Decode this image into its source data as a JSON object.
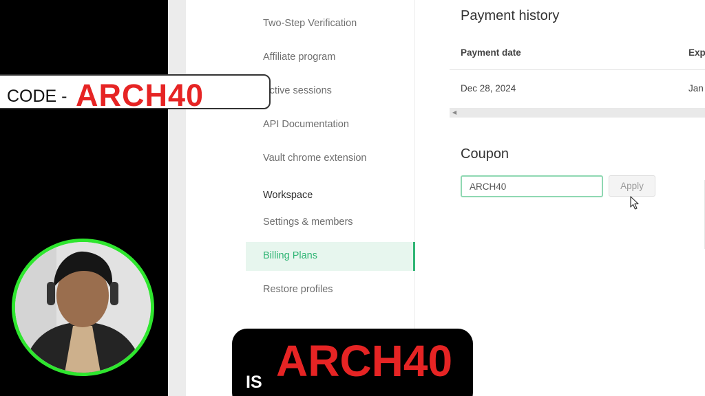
{
  "sidebar": {
    "items": [
      {
        "label": "Two-Step Verification"
      },
      {
        "label": "Affiliate program"
      },
      {
        "label": "Active sessions"
      },
      {
        "label": "API Documentation"
      },
      {
        "label": "Vault chrome extension"
      }
    ],
    "workspace_heading": "Workspace",
    "workspace_items": [
      {
        "label": "Settings & members"
      },
      {
        "label": "Billing Plans",
        "active": true
      },
      {
        "label": "Restore profiles"
      }
    ]
  },
  "payment_history": {
    "title": "Payment history",
    "columns": [
      "Payment date",
      "Exp"
    ],
    "rows": [
      [
        "Dec 28, 2024",
        "Jan"
      ]
    ]
  },
  "coupon": {
    "title": "Coupon",
    "value": "ARCH40",
    "apply_label": "Apply"
  },
  "overlay": {
    "code_prefix": "CODE -",
    "code_value": "ARCH40",
    "is_prefix": "IS",
    "is_value": "ARCH40"
  },
  "colors": {
    "accent_green": "#2fb574",
    "promo_red": "#e62424",
    "avatar_ring": "#2ee62e"
  }
}
